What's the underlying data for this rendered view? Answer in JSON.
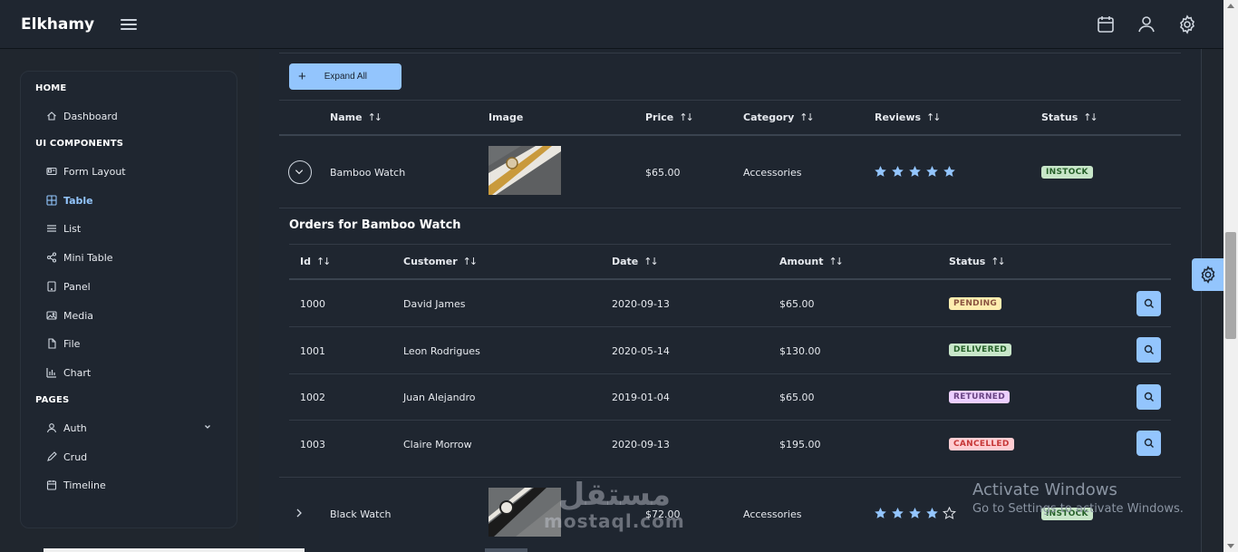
{
  "app": {
    "brand": "Elkhamy"
  },
  "topbar": {
    "icons": [
      "menu-icon",
      "calendar-icon",
      "user-icon",
      "settings-icon"
    ]
  },
  "sidebar": {
    "sections": [
      {
        "title": "HOME",
        "items": [
          {
            "label": "Dashboard",
            "icon": "home-icon"
          }
        ]
      },
      {
        "title": "UI COMPONENTS",
        "items": [
          {
            "label": "Form Layout",
            "icon": "id-card-icon"
          },
          {
            "label": "Table",
            "icon": "table-icon",
            "active": true
          },
          {
            "label": "List",
            "icon": "list-icon"
          },
          {
            "label": "Mini Table",
            "icon": "share-icon"
          },
          {
            "label": "Panel",
            "icon": "tablet-icon"
          },
          {
            "label": "Media",
            "icon": "image-icon"
          },
          {
            "label": "File",
            "icon": "file-icon"
          },
          {
            "label": "Chart",
            "icon": "chart-bar-icon"
          }
        ]
      },
      {
        "title": "PAGES",
        "items": [
          {
            "label": "Auth",
            "icon": "user-icon"
          },
          {
            "label": "Crud",
            "icon": "pencil-icon"
          },
          {
            "label": "Timeline",
            "icon": "calendar-icon"
          }
        ]
      }
    ]
  },
  "toolbar": {
    "expand_all_label": "Expand All"
  },
  "products": {
    "columns": [
      "Name",
      "Image",
      "Price",
      "Category",
      "Reviews",
      "Status"
    ],
    "rows": [
      {
        "name": "Bamboo Watch",
        "price": "$65.00",
        "category": "Accessories",
        "rating": 5,
        "status": "INSTOCK",
        "expanded": true
      },
      {
        "name": "Black Watch",
        "price": "$72.00",
        "category": "Accessories",
        "rating": 4,
        "status": "INSTOCK",
        "expanded": false
      }
    ]
  },
  "orders": {
    "title": "Orders for Bamboo Watch",
    "columns": [
      "Id",
      "Customer",
      "Date",
      "Amount",
      "Status"
    ],
    "rows": [
      {
        "id": "1000",
        "customer": "David James",
        "date": "2020-09-13",
        "amount": "$65.00",
        "status": "PENDING"
      },
      {
        "id": "1001",
        "customer": "Leon Rodrigues",
        "date": "2020-05-14",
        "amount": "$130.00",
        "status": "DELIVERED"
      },
      {
        "id": "1002",
        "customer": "Juan Alejandro",
        "date": "2019-01-04",
        "amount": "$65.00",
        "status": "RETURNED"
      },
      {
        "id": "1003",
        "customer": "Claire Morrow",
        "date": "2020-09-13",
        "amount": "$195.00",
        "status": "CANCELLED"
      }
    ]
  },
  "watermark": {
    "line1": "Activate Windows",
    "line2": "Go to Settings to activate Windows."
  },
  "overlay": {
    "arabic": "مستقل",
    "latin": "mostaql.com"
  },
  "colors": {
    "accent": "#93c5fd",
    "background": "#1f2630",
    "star": "#93c5fd"
  }
}
